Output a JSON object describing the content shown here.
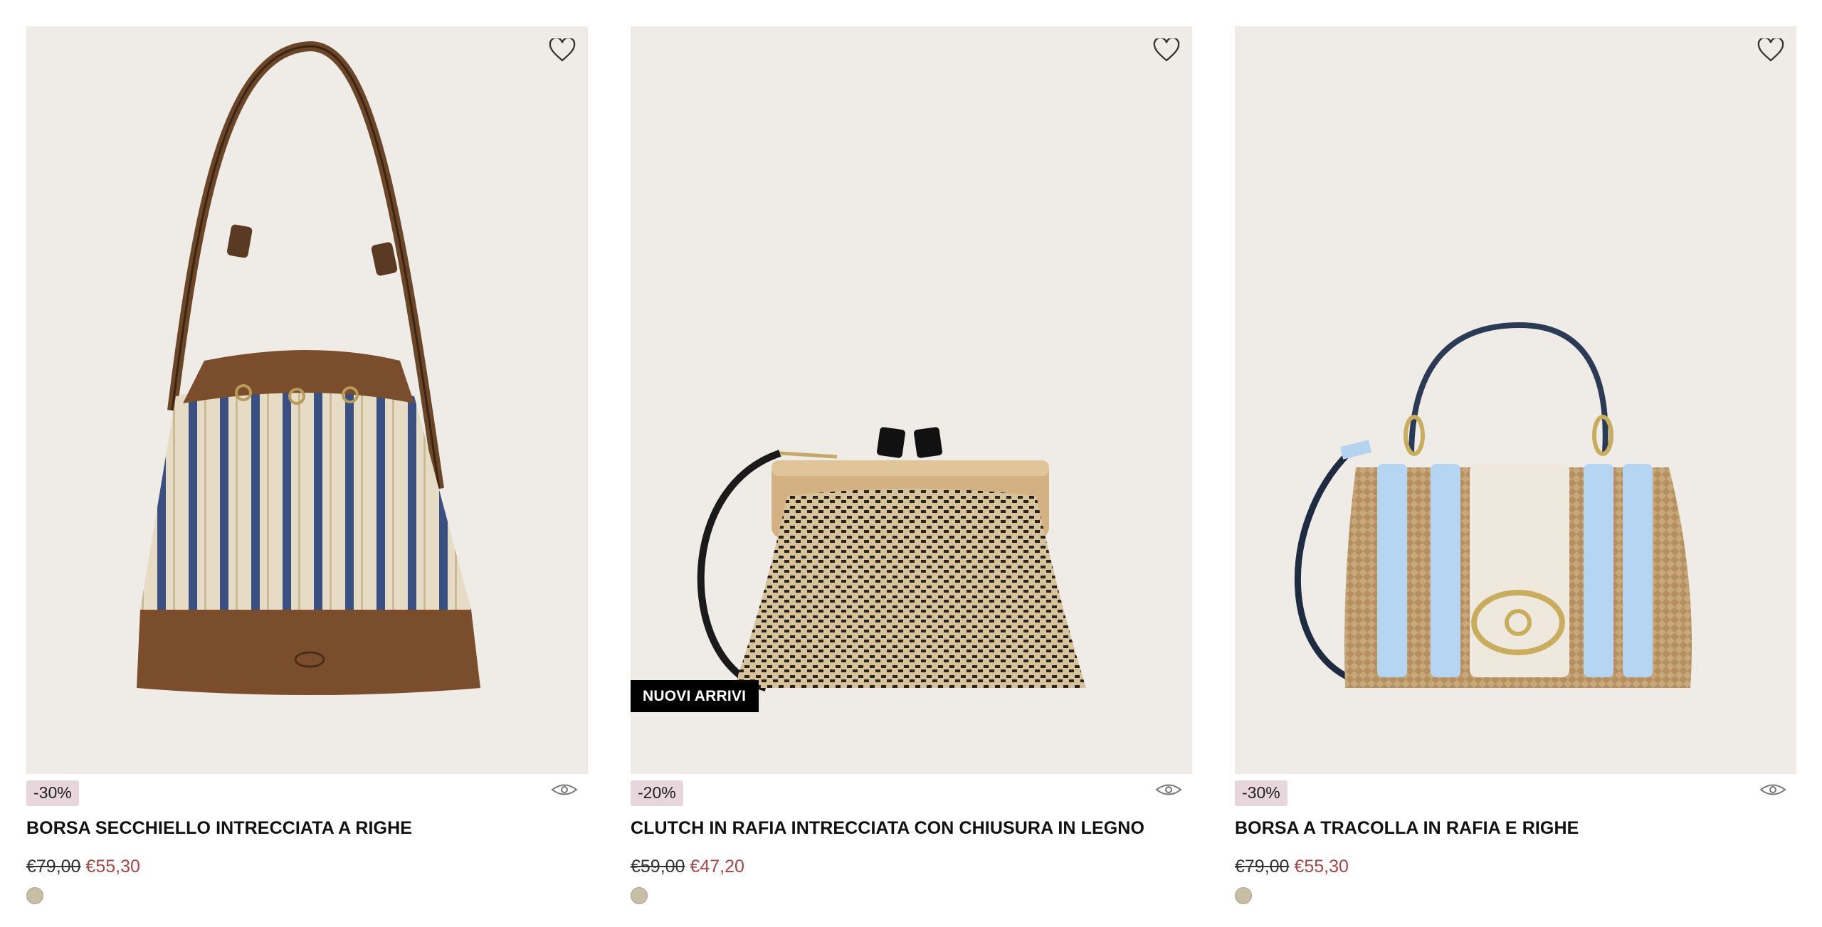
{
  "products": [
    {
      "title": "BORSA SECCHIELLO INTRECCIATA A RIGHE",
      "discount": "-30%",
      "price_old": "€79,00",
      "price_new": "€55,30",
      "badge": "",
      "swatch_color": "#c6bea5"
    },
    {
      "title": "CLUTCH IN RAFIA INTRECCIATA CON CHIUSURA IN LEGNO",
      "discount": "-20%",
      "price_old": "€59,00",
      "price_new": "€47,20",
      "badge": "NUOVI ARRIVI",
      "swatch_color": "#c6bea5"
    },
    {
      "title": "BORSA A TRACOLLA IN RAFIA E RIGHE",
      "discount": "-30%",
      "price_old": "€79,00",
      "price_new": "€55,30",
      "badge": "",
      "swatch_color": "#c6bea5"
    }
  ],
  "icons": {
    "wishlist": "heart-outline-icon",
    "quick_view": "eye-icon"
  },
  "colors": {
    "image_background": "#efece8",
    "sale_price": "#a04848",
    "discount_badge": "#e7d6dc",
    "new_badge": "#000000"
  }
}
